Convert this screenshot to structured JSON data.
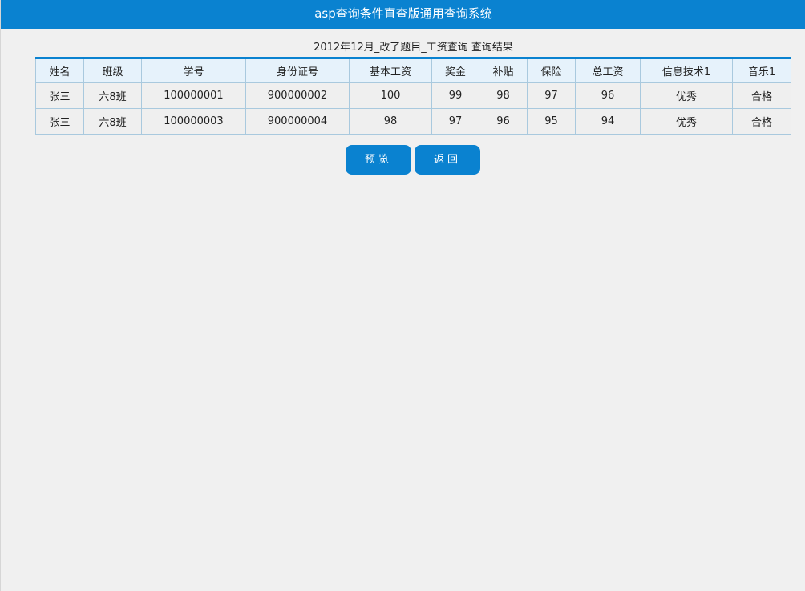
{
  "header": {
    "title": "asp查询条件直查版通用查询系统"
  },
  "results": {
    "caption": "2012年12月_改了题目_工资查询 查询结果",
    "columns": [
      "姓名",
      "班级",
      "学号",
      "身份证号",
      "基本工资",
      "奖金",
      "补贴",
      "保险",
      "总工资",
      "信息技术1",
      "音乐1"
    ],
    "rows": [
      [
        "张三",
        "六8班",
        "100000001",
        "900000002",
        "100",
        "99",
        "98",
        "97",
        "96",
        "优秀",
        "合格"
      ],
      [
        "张三",
        "六8班",
        "100000003",
        "900000004",
        "98",
        "97",
        "96",
        "95",
        "94",
        "优秀",
        "合格"
      ]
    ]
  },
  "actions": {
    "preview_label": "预览",
    "back_label": "返回"
  },
  "colors": {
    "accent": "#0a82d0",
    "header_cell_bg": "#e6f2fb",
    "border": "#a9c9de",
    "page_bg": "#f0f0f0"
  }
}
